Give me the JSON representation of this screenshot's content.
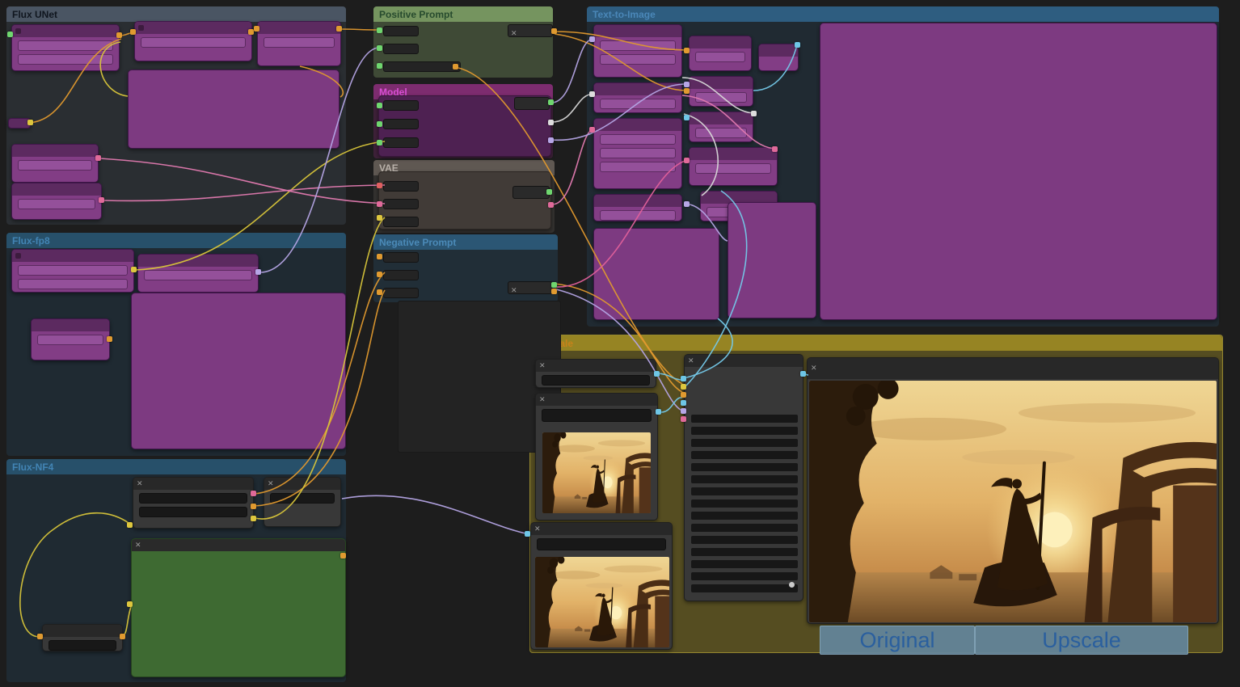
{
  "canvas": {
    "background": "#1d1d1d"
  },
  "groups": {
    "flux_unet": {
      "title": "Flux UNet",
      "color": "#4a5563"
    },
    "flux_fp8": {
      "title": "Flux-fp8",
      "color": "#27506a"
    },
    "flux_nf4": {
      "title": "Flux-NF4",
      "color": "#27506a"
    },
    "positive_prompt": {
      "title": "Positive Prompt",
      "color": "#75945f"
    },
    "model": {
      "title": "Model",
      "color": "#7d2c6f"
    },
    "vae": {
      "title": "VAE",
      "color": "#5f5852"
    },
    "negative_prompt": {
      "title": "Negative Prompt",
      "color": "#2b5674"
    },
    "text_to_image": {
      "title": "Text-to-Image",
      "color": "#2e5d80"
    },
    "upscale": {
      "title": "Upscale",
      "color": "#968423"
    }
  },
  "compare_bar": {
    "original_label": "Original",
    "upscale_label": "Upscale"
  },
  "icons": {
    "collapse": "✕"
  },
  "wire_colors": {
    "yellow": "#d8c53a",
    "orange": "#e0992e",
    "pink": "#e27ab0",
    "magenta_pink": "#e0609a",
    "lavender": "#b4a4e4",
    "blue": "#74c8e8",
    "white": "#d8d8d8"
  },
  "node_colors": {
    "purple": "#823d85",
    "dark": "#383838",
    "green": "#3e6a32"
  }
}
